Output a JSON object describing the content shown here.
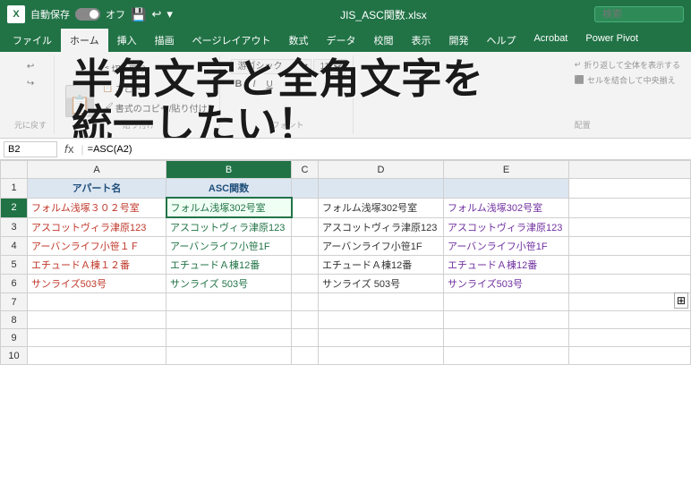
{
  "titlebar": {
    "logo": "X",
    "autosave": "自動保存",
    "autosave_state": "オフ",
    "filename": "JIS_ASC関数.xlsx",
    "search_placeholder": "検索"
  },
  "ribbon": {
    "tabs": [
      "ファイル",
      "ホーム",
      "挿入",
      "描画",
      "ページレイアウト",
      "数式",
      "データ",
      "校閲",
      "表示",
      "開発",
      "ヘルプ",
      "Acrobat",
      "Power Pivot"
    ],
    "active_tab": "ホーム",
    "paste_label": "貼り付け",
    "copy_label": "コピー",
    "cut_label": "切り取り",
    "format_painter_label": "書式のコピー/貼り付け",
    "undo_label": "元に戻す",
    "undo_group_label": "元に戻す",
    "font_name": "游ゴシック",
    "font_size": "11",
    "bold": "B",
    "italic": "I",
    "underline": "U",
    "wrap_text": "折り返して全体を表示する",
    "merge_cells": "セルを結合して中央揃え",
    "alignment_group": "配置"
  },
  "overlay": {
    "line1": "半角文字と全角文字を",
    "line2": "統一したい！"
  },
  "formula_bar": {
    "cell_ref": "B2",
    "formula": "=ASC(A2)"
  },
  "sheet": {
    "col_headers": [
      "",
      "A",
      "B",
      "C",
      "D",
      "E",
      ""
    ],
    "row1_headers": [
      "アパート名",
      "ASC関数",
      "",
      "",
      ""
    ],
    "rows": [
      {
        "row_num": "2",
        "a": "フォルム浅塚３０２号室",
        "b": "フォルム浅塚302号室",
        "c": "",
        "d": "フォルム浅塚302号室",
        "e": "フォルム浅塚302号室",
        "b_active": true
      },
      {
        "row_num": "3",
        "a": "アスコットヴィラ津原123",
        "b": "アスコットヴィラ津原123",
        "c": "",
        "d": "アスコットヴィラ津原123",
        "e": "アスコットヴィラ津原123"
      },
      {
        "row_num": "4",
        "a": "アーバンライフ小笹１Ｆ",
        "b": "アーバンライフ小笹1F",
        "c": "",
        "d": "アーバンライフ小笹1F",
        "e": "アーバンライフ小笹1F"
      },
      {
        "row_num": "5",
        "a": "エチュードＡ棟１２番",
        "b": "エチュードＡ棟12番",
        "c": "",
        "d": "エチュードＡ棟12番",
        "e": "エチュードＡ棟12番"
      },
      {
        "row_num": "6",
        "a": "サンライズ503号",
        "b": "サンライズ 503号",
        "c": "",
        "d": "サンライズ 503号",
        "e": "サンライズ503号"
      }
    ],
    "empty_rows": [
      "7",
      "8",
      "9",
      "10"
    ]
  }
}
